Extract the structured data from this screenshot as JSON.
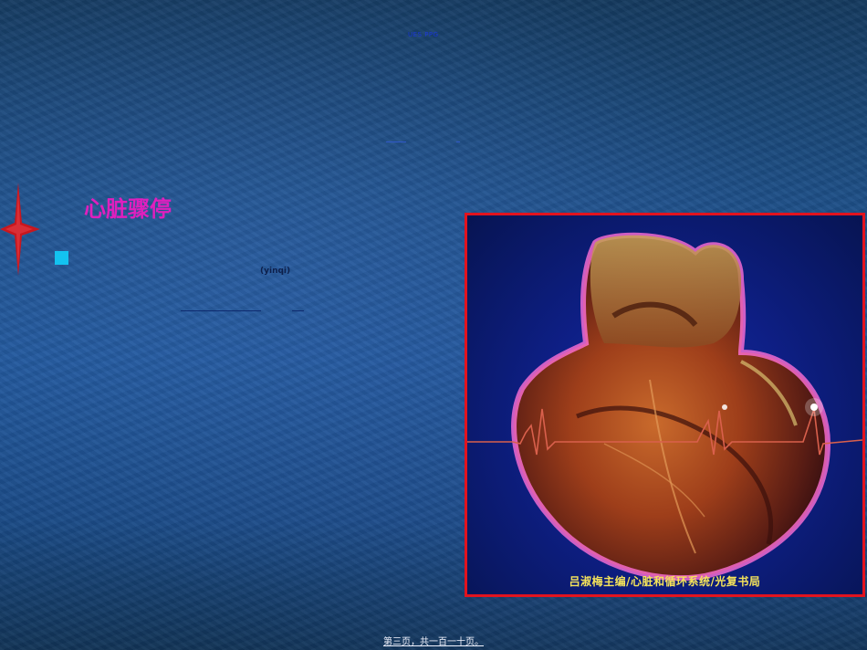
{
  "slide": {
    "header_text": "UES PPG",
    "title": "心脏骤停",
    "note": "(yinqi)",
    "photo_caption": "吕淑梅主编/心脏和循环系统/光复书局",
    "footer": "第三页，共一百一十页。"
  },
  "icons": {
    "corner_ornament": "red-four-point-star-icon",
    "bullet": "cyan-square-bullet-icon"
  },
  "colors": {
    "title": "#e01fbe",
    "bullet": "#13c2f0",
    "photo_border": "#e2131e",
    "ornament": "#c8171e"
  }
}
